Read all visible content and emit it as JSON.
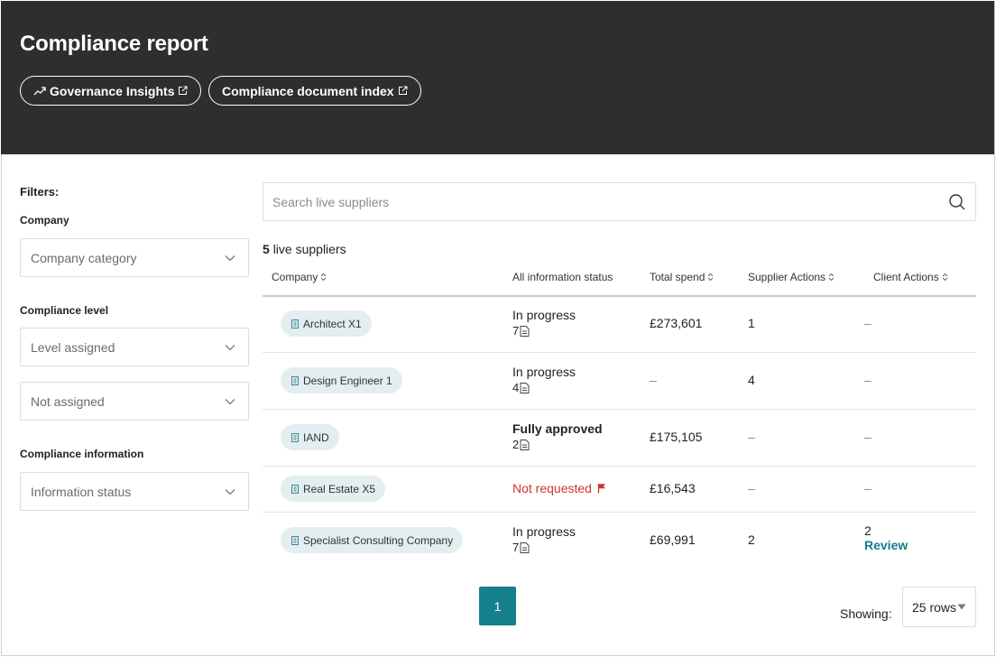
{
  "header": {
    "title": "Compliance report",
    "links": [
      {
        "label": "Governance Insights"
      },
      {
        "label": "Compliance document index"
      }
    ]
  },
  "filters": {
    "title": "Filters:",
    "company_label": "Company",
    "company_category": "Company category",
    "compliance_level_label": "Compliance level",
    "level_assigned": "Level assigned",
    "not_assigned": "Not assigned",
    "compliance_info_label": "Compliance information",
    "information_status": "Information status"
  },
  "search": {
    "placeholder": "Search live suppliers"
  },
  "summary": {
    "count": "5",
    "text": "live suppliers"
  },
  "table": {
    "columns": [
      "Company",
      "All information status",
      "Total spend",
      "Supplier Actions",
      "Client Actions"
    ],
    "rows": [
      {
        "company": "Architect X1",
        "status": "In progress",
        "docs": "7",
        "spend": "£273,601",
        "supplier_actions": "1",
        "client_actions": "–"
      },
      {
        "company": "Design Engineer 1",
        "status": "In progress",
        "docs": "4",
        "spend": "–",
        "supplier_actions": "4",
        "client_actions": "–"
      },
      {
        "company": "IAND",
        "status": "Fully approved",
        "docs": "2",
        "spend": "£175,105",
        "supplier_actions": "–",
        "client_actions": "–"
      },
      {
        "company": "Real Estate X5",
        "status": "Not requested",
        "docs": "",
        "spend": "£16,543",
        "supplier_actions": "–",
        "client_actions": "–"
      },
      {
        "company": "Specialist Consulting Company",
        "status": "In progress",
        "docs": "7",
        "spend": "£69,991",
        "supplier_actions": "2",
        "client_actions": "2",
        "client_action_link": "Review"
      }
    ]
  },
  "pagination": {
    "current_page": "1",
    "showing_label": "Showing:",
    "rows_value": "25 rows"
  },
  "colors": {
    "header_bg": "#2e2e2e",
    "accent": "#16808c",
    "chip_bg": "#e4edef",
    "alert": "#d0352c"
  },
  "icons": [
    "trend-up-icon",
    "external-link-icon",
    "chevron-down-icon",
    "search-icon",
    "sort-icon",
    "building-icon",
    "document-icon",
    "flag-icon",
    "caret-down-icon"
  ]
}
